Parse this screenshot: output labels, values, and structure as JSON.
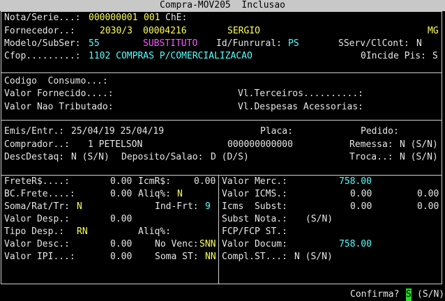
{
  "window": {
    "title": "Compra-MOV205  Inclusao"
  },
  "header": {
    "nota_label": "Nota/Serie...:",
    "nota_number": "000000001",
    "serie": "001",
    "che_label": "ChE:",
    "fornecedor_label": "Fornecedor..:",
    "fornecedor_code": "2030/3",
    "fornecedor_cnpj": "00004216",
    "fornecedor_name": "SERGIO",
    "fornecedor_uf": "MG",
    "modelo_label": "Modelo/SubSer:",
    "modelo_value": "55",
    "modelo_desc": "SUBSTITUTO",
    "funrural_label": "Id/Funrural:",
    "funrural_value": "PS",
    "sserv_label": "SServ/ClCont:",
    "sserv_value": "N",
    "cfop_label": "Cfop.........:",
    "cfop_value": "1102 COMPRAS P/COMERCIALIZACAO",
    "incide_pis_label": "0Incide Pis:",
    "incide_pis_value": "S"
  },
  "consumo": {
    "codigo_label": "Codigo  Consumo...:",
    "valor_fornecido_label": "Valor Fornecido....:",
    "vl_terceiros_label": "Vl.Terceiros..........:",
    "valor_nao_trib_label": "Valor Nao Tributado:",
    "vl_despesas_label": "Vl.Despesas Acessorias:"
  },
  "entry": {
    "emis_label": "Emis/Entr.:",
    "emis_value": "25/04/19 25/04/19",
    "placa_label": "Placa:",
    "pedido_label": "Pedido:",
    "comprador_label": "Comprador..:",
    "comprador_value": "1 PETELSON",
    "comprador_code": "000000000000",
    "remessa_label": "Remessa:",
    "remessa_value": "N (S/N)",
    "descdestaq_label": "DescDestaq:",
    "descdestaq_value": "N (S/N)",
    "deposito_label": "Deposito/Salao:",
    "deposito_value": "D (D/S)",
    "troca_label": "Troca..:",
    "troca_value": "N (S/N)"
  },
  "left": {
    "frete_label": "FreteR$....:",
    "frete_value": "0.00",
    "icmr_label": "IcmR$:",
    "icmr_value": "0.00",
    "bcfrete_label": "BC.Frete....:",
    "bcfrete_value": "0.00",
    "aliq_label": "Aliq%:",
    "aliq_value": "N",
    "soma_label": "Soma/Rat/Tr:",
    "soma_value": "N",
    "indfrt_label": "Ind-Frt:",
    "indfrt_value": "9",
    "valordesp_label": "Valor Desp.:",
    "valordesp_value": "0.00",
    "tipodesp_label": "Tipo Desp.:",
    "tipodesp_value": "RN",
    "aliq2_label": "Aliq%:",
    "valordesc_label": "Valor Desc.:",
    "valordesc_value": "0.00",
    "novenc_label": "No Venc:",
    "novenc_value": "SNN",
    "valoripi_label": "Valor IPI...:",
    "valoripi_value": "0.00",
    "somast_label": "Soma ST:",
    "somast_value": "NN"
  },
  "right": {
    "merc_label": "Valor Merc.:",
    "merc_value": "758.00",
    "icms_label": "Valor ICMS.:",
    "icms_value1": "0.00",
    "icms_value2": "0.00",
    "icmssubst_label": "Icms  Subst:",
    "icmssubst_value1": "0.00",
    "icmssubst_value2": "0.00",
    "substnota_label": "Subst Nota.:",
    "substnota_value": "(S/N)",
    "fcp_label": "FCP/FCP ST.:",
    "docum_label": "Valor Docum:",
    "docum_value": "758.00",
    "compl_label": "Compl.ST...:",
    "compl_value": "N (S/N)"
  },
  "footer": {
    "confirma_label": "Confirma?",
    "confirma_value": "S",
    "confirma_options": "(S/N)"
  }
}
